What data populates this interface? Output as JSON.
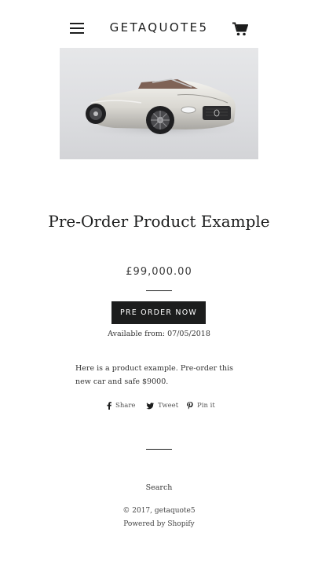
{
  "header": {
    "brand": "GETAQUOTE5",
    "menu_icon": "hamburger-menu-icon",
    "cart_icon": "shopping-cart-icon"
  },
  "product": {
    "title": "Pre-Order Product Example",
    "price": "£99,000.00",
    "preorder_label": "PRE ORDER NOW",
    "available": "Available from: 07/05/2018",
    "description": "Here is a product example. Pre-order this new car and safe $9000."
  },
  "social": {
    "share_label": "Share",
    "tweet_label": "Tweet",
    "pin_label": "Pin it"
  },
  "footer": {
    "search_label": "Search",
    "copyright": "© 2017, getaquote5",
    "powered_by": "Powered by Shopify"
  },
  "colors": {
    "text": "#1c1d1d",
    "button_bg": "#1c1d1d",
    "button_text": "#ffffff",
    "background": "#ffffff"
  }
}
